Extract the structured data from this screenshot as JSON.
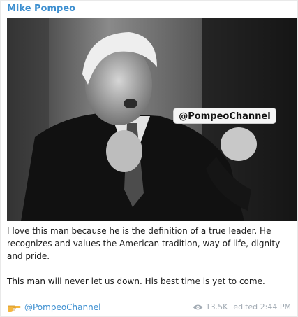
{
  "message": {
    "sender": "Mike Pompeo",
    "watermark": "@PompeoChannel",
    "paragraphs": [
      "I love this man because he is the definition of a true leader. He recognizes and values the American tradition, way of life, dignity and pride.",
      "This man will never let us down. His best time is yet to come."
    ],
    "link": "@PompeoChannel",
    "views": "13.5K",
    "edited": "edited 2:44 PM"
  },
  "icons": {
    "link_prefix": "pointing-hand-icon",
    "views": "eye-icon"
  },
  "colors": {
    "accent": "#3d8fd0",
    "meta": "#a1aab3"
  }
}
